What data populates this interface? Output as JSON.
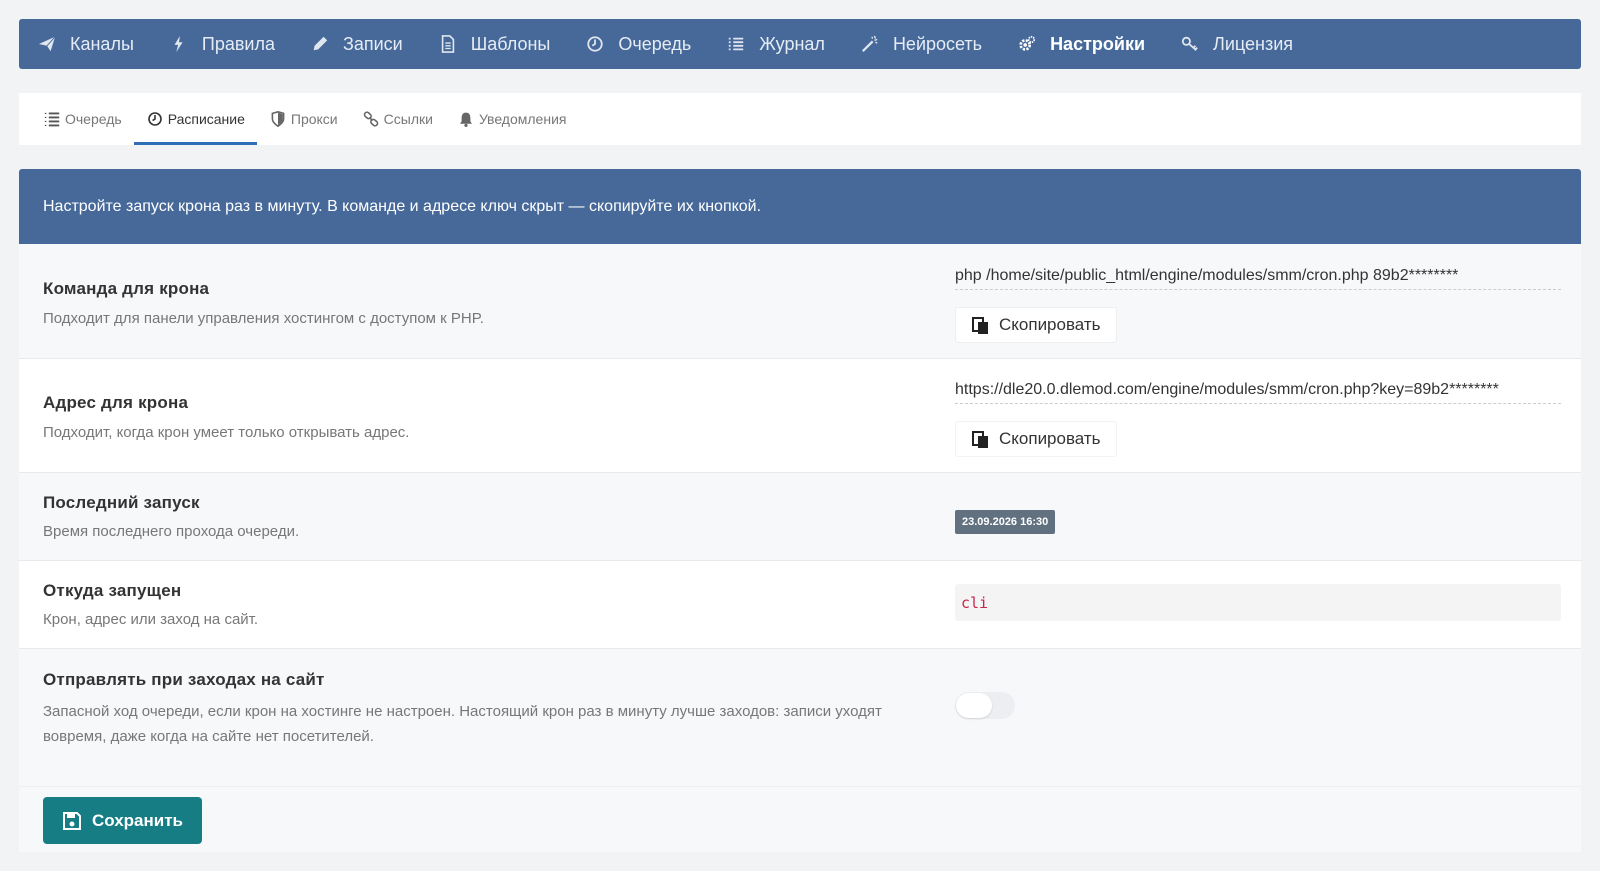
{
  "topnav": {
    "items": [
      {
        "label": "Каналы",
        "icon": "paper-plane-icon"
      },
      {
        "label": "Правила",
        "icon": "bolt-icon"
      },
      {
        "label": "Записи",
        "icon": "pencil-icon"
      },
      {
        "label": "Шаблоны",
        "icon": "file-icon"
      },
      {
        "label": "Очередь",
        "icon": "clock-icon"
      },
      {
        "label": "Журнал",
        "icon": "list-icon"
      },
      {
        "label": "Нейросеть",
        "icon": "magic-wand-icon"
      },
      {
        "label": "Настройки",
        "icon": "gears-icon",
        "active": true
      },
      {
        "label": "Лицензия",
        "icon": "key-icon"
      }
    ]
  },
  "subtabs": {
    "items": [
      {
        "label": "Очередь",
        "icon": "numbered-list-icon"
      },
      {
        "label": "Расписание",
        "icon": "clock-icon",
        "active": true
      },
      {
        "label": "Прокси",
        "icon": "shield-icon"
      },
      {
        "label": "Ссылки",
        "icon": "link-icon"
      },
      {
        "label": "Уведомления",
        "icon": "bell-icon"
      }
    ]
  },
  "notice": {
    "text": "Настройте запуск крона раз в минуту. В команде и адресе ключ скрыт — скопируйте их кнопкой."
  },
  "settings": {
    "cron_command": {
      "label": "Команда для крона",
      "desc": "Подходит для панели управления хостингом с доступом к PHP.",
      "value": "php /home/site/public_html/engine/modules/smm/cron.php 89b2********",
      "copy_label": "Скопировать"
    },
    "cron_url": {
      "label": "Адрес для крона",
      "desc": "Подходит, когда крон умеет только открывать адрес.",
      "value": "https://dle20.0.dlemod.com/engine/modules/smm/cron.php?key=89b2********",
      "copy_label": "Скопировать"
    },
    "last_run": {
      "label": "Последний запуск",
      "desc": "Время последнего прохода очереди.",
      "value": "23.09.2026 16:30"
    },
    "run_source": {
      "label": "Откуда запущен",
      "desc": "Крон, адрес или заход на сайт.",
      "value": "cli"
    },
    "send_on_visits": {
      "label": "Отправлять при заходах на сайт",
      "desc": "Запасной ход очереди, если крон на хостинге не настроен. Настоящий крон раз в минуту лучше заходов: записи уходят вовремя, даже когда на сайте нет посетителей.",
      "enabled": false
    }
  },
  "footer": {
    "save_label": "Сохранить"
  },
  "colors": {
    "nav_bg": "#46699a",
    "accent": "#2f6db5",
    "save_bg": "#167d85",
    "badge_bg": "#617180",
    "code_color": "#c7254e"
  }
}
